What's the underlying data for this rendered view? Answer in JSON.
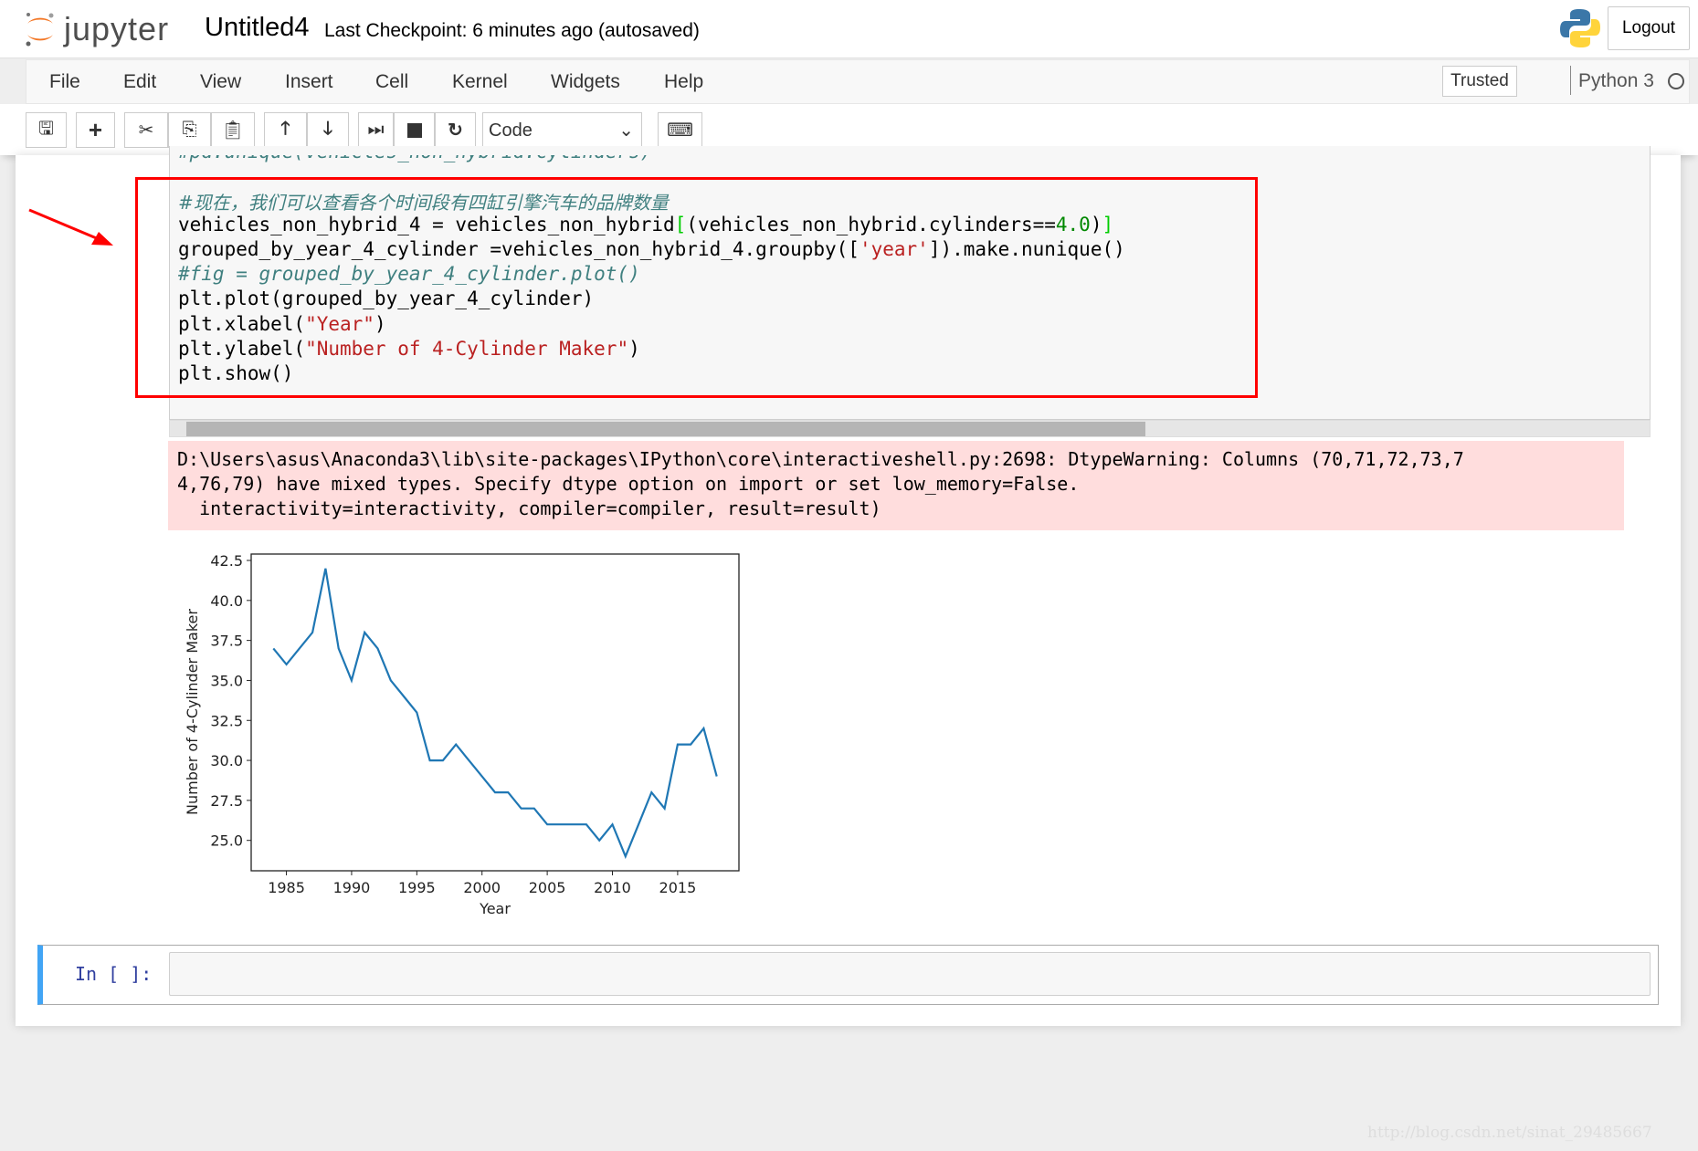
{
  "header": {
    "logo_text": "jupyter",
    "notebook_title": "Untitled4",
    "checkpoint": "Last Checkpoint: 6 minutes ago (autosaved)",
    "logout_label": "Logout"
  },
  "menu": {
    "items": [
      "File",
      "Edit",
      "View",
      "Insert",
      "Cell",
      "Kernel",
      "Widgets",
      "Help"
    ],
    "trusted_label": "Trusted",
    "kernel_name": "Python 3"
  },
  "toolbar": {
    "cell_type": "Code",
    "buttons": [
      "save-icon",
      "plus-icon",
      "cut-icon",
      "copy-icon",
      "paste-icon",
      "arrow-up-icon",
      "arrow-down-icon",
      "run-icon",
      "stop-icon",
      "restart-icon",
      "keyboard-icon"
    ]
  },
  "cell": {
    "truncated_line": "#pd.unique(vehicles_non_hybrid.cylinders)",
    "comment1": "#现在，我们可以查看各个时间段有四缸引擎汽车的品牌数量",
    "line1a": "vehicles_non_hybrid_4 = vehicles_non_hybrid",
    "line1b": "[",
    "line1c": "(vehicles_non_hybrid.cylinders==",
    "line1d": "4.0",
    "line1e": ")",
    "line1f": "]",
    "line2a": "grouped_by_year_4_cylinder =vehicles_non_hybrid_4.groupby([",
    "line2b": "'year'",
    "line2c": "]).make.nunique()",
    "comment2": "#fig = grouped_by_year_4_cylinder.plot()",
    "line3": "plt.plot(grouped_by_year_4_cylinder)",
    "line4a": "plt.xlabel(",
    "line4b": "\"Year\"",
    "line4c": ")",
    "line5a": "plt.ylabel(",
    "line5b": "\"Number of 4-Cylinder Maker\"",
    "line5c": ")",
    "line6": "plt.show()"
  },
  "warning": {
    "lines": [
      "D:\\Users\\asus\\Anaconda3\\lib\\site-packages\\IPython\\core\\interactiveshell.py:2698: DtypeWarning: Columns (70,71,72,73,7",
      "4,76,79) have mixed types. Specify dtype option on import or set low_memory=False.",
      "  interactivity=interactivity, compiler=compiler, result=result)"
    ]
  },
  "chart_data": {
    "type": "line",
    "x": [
      1984,
      1985,
      1986,
      1987,
      1988,
      1989,
      1990,
      1991,
      1992,
      1993,
      1994,
      1995,
      1996,
      1997,
      1998,
      1999,
      2000,
      2001,
      2002,
      2003,
      2004,
      2005,
      2006,
      2007,
      2008,
      2009,
      2010,
      2011,
      2012,
      2013,
      2014,
      2015,
      2016,
      2017,
      2018
    ],
    "y": [
      37,
      36,
      37,
      38,
      42,
      37,
      35,
      38,
      37,
      35,
      34,
      33,
      30,
      30,
      31,
      30,
      29,
      28,
      28,
      27,
      27,
      26,
      26,
      26,
      26,
      25,
      26,
      24,
      26,
      28,
      27,
      31,
      31,
      32,
      29
    ],
    "xlabel": "Year",
    "ylabel": "Number of 4-Cylinder Maker",
    "xticks": [
      "1985",
      "1990",
      "1995",
      "2000",
      "2005",
      "2010",
      "2015"
    ],
    "yticks": [
      "25.0",
      "27.5",
      "30.0",
      "32.5",
      "35.0",
      "37.5",
      "40.0",
      "42.5"
    ],
    "xlim": [
      1982.3,
      2019.7
    ],
    "ylim": [
      23.1,
      42.9
    ],
    "grid": false,
    "color": "#1f77b4"
  },
  "last_cell": {
    "prompt": "In [ ]:"
  },
  "watermark": "http://blog.csdn.net/sinat_29485667"
}
